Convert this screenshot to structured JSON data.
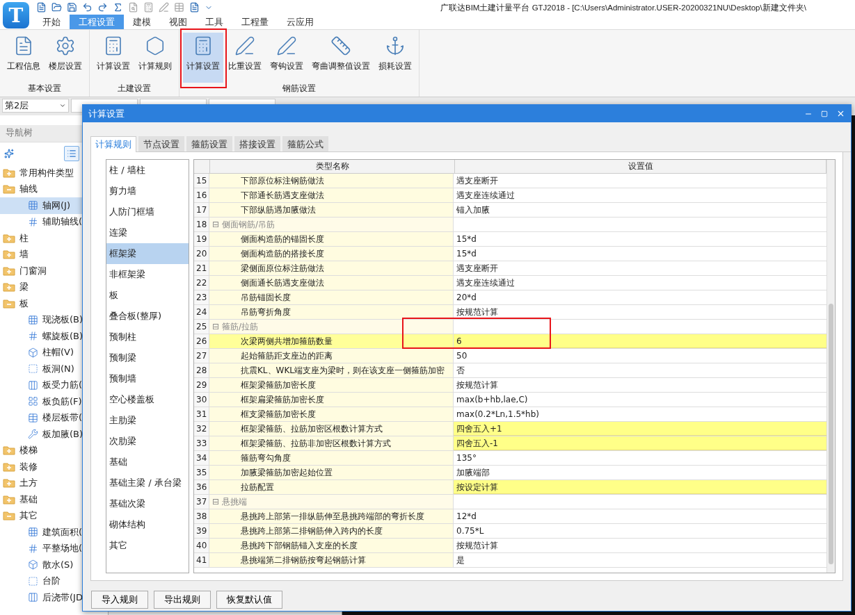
{
  "app": {
    "logo": "T",
    "title": "广联达BIM土建计量平台 GTJ2018 - [C:\\Users\\Administrator.USER-20200321NU\\Desktop\\新建文件夹\\"
  },
  "tabs": [
    {
      "label": "开始",
      "selected": false
    },
    {
      "label": "工程设置",
      "selected": true
    },
    {
      "label": "建模",
      "selected": false
    },
    {
      "label": "视图",
      "selected": false
    },
    {
      "label": "工具",
      "selected": false
    },
    {
      "label": "工程量",
      "selected": false
    },
    {
      "label": "云应用",
      "selected": false
    }
  ],
  "ribbon": [
    {
      "group": "基本设置",
      "buttons": [
        {
          "label": "工程信息",
          "selected": false
        },
        {
          "label": "楼层设置",
          "selected": false
        }
      ]
    },
    {
      "group": "土建设置",
      "buttons": [
        {
          "label": "计算设置",
          "selected": false
        },
        {
          "label": "计算规则",
          "selected": false
        }
      ]
    },
    {
      "group": "钢筋设置",
      "buttons": [
        {
          "label": "计算设置",
          "selected": true
        },
        {
          "label": "比重设置",
          "selected": false
        },
        {
          "label": "弯钩设置",
          "selected": false
        },
        {
          "label": "弯曲调整值设置",
          "selected": false
        },
        {
          "label": "损耗设置",
          "selected": false
        }
      ]
    }
  ],
  "selectors": [
    {
      "value": "第2层"
    }
  ],
  "navigator": {
    "title": "导航树",
    "tree": [
      {
        "label": "常用构件类型",
        "expanded": false
      },
      {
        "label": "轴线",
        "expanded": true,
        "children": [
          {
            "label": "轴网(J)",
            "selected": true
          },
          {
            "label": "辅助轴线(",
            "selected": false
          }
        ]
      },
      {
        "label": "柱",
        "expanded": false
      },
      {
        "label": "墙",
        "expanded": false
      },
      {
        "label": "门窗洞",
        "expanded": false
      },
      {
        "label": "梁",
        "expanded": false
      },
      {
        "label": "板",
        "expanded": true,
        "children": [
          {
            "label": "现浇板(B)",
            "selected": false
          },
          {
            "label": "螺旋板(B)",
            "selected": false
          },
          {
            "label": "柱帽(V)",
            "selected": false
          },
          {
            "label": "板洞(N)",
            "selected": false
          },
          {
            "label": "板受力筋(",
            "selected": false
          },
          {
            "label": "板负筋(F)",
            "selected": false
          },
          {
            "label": "楼层板带(",
            "selected": false
          },
          {
            "label": "板加腋(B)",
            "selected": false
          }
        ]
      },
      {
        "label": "楼梯",
        "expanded": false
      },
      {
        "label": "装修",
        "expanded": false
      },
      {
        "label": "土方",
        "expanded": false
      },
      {
        "label": "基础",
        "expanded": false
      },
      {
        "label": "其它",
        "expanded": true,
        "children": [
          {
            "label": "建筑面积(",
            "selected": false
          },
          {
            "label": "平整场地(",
            "selected": false
          },
          {
            "label": "散水(S)",
            "selected": false
          },
          {
            "label": "台阶",
            "selected": false
          },
          {
            "label": "后浇带(JD",
            "selected": false
          }
        ]
      }
    ]
  },
  "dialog": {
    "title": "计算设置",
    "tabs": [
      {
        "label": "计算规则",
        "selected": true
      },
      {
        "label": "节点设置",
        "selected": false
      },
      {
        "label": "箍筋设置",
        "selected": false
      },
      {
        "label": "搭接设置",
        "selected": false
      },
      {
        "label": "箍筋公式",
        "selected": false
      }
    ],
    "categories": [
      {
        "label": "柱 / 墙柱",
        "selected": false
      },
      {
        "label": "剪力墙",
        "selected": false
      },
      {
        "label": "人防门框墙",
        "selected": false
      },
      {
        "label": "连梁",
        "selected": false
      },
      {
        "label": "框架梁",
        "selected": true
      },
      {
        "label": "非框架梁",
        "selected": false
      },
      {
        "label": "板",
        "selected": false
      },
      {
        "label": "叠合板(整厚)",
        "selected": false
      },
      {
        "label": "预制柱",
        "selected": false
      },
      {
        "label": "预制梁",
        "selected": false
      },
      {
        "label": "预制墙",
        "selected": false
      },
      {
        "label": "空心楼盖板",
        "selected": false
      },
      {
        "label": "主肋梁",
        "selected": false
      },
      {
        "label": "次肋梁",
        "selected": false
      },
      {
        "label": "基础",
        "selected": false
      },
      {
        "label": "基础主梁 / 承台梁",
        "selected": false
      },
      {
        "label": "基础次梁",
        "selected": false
      },
      {
        "label": "砌体结构",
        "selected": false
      },
      {
        "label": "其它",
        "selected": false
      }
    ],
    "columns": [
      "类型名称",
      "设置值"
    ],
    "rows": [
      {
        "num": "15",
        "kind": "item",
        "name": "下部原位标注钢筋做法",
        "value": "遇支座断开",
        "highlighted": false,
        "selected": false
      },
      {
        "num": "16",
        "kind": "item",
        "name": "下部通长筋遇支座做法",
        "value": "遇支座连续通过",
        "highlighted": false,
        "selected": false
      },
      {
        "num": "17",
        "kind": "item",
        "name": "下部纵筋遇加腋做法",
        "value": "锚入加腋",
        "highlighted": false,
        "selected": false
      },
      {
        "num": "18",
        "kind": "group",
        "name": "侧面钢筋/吊筋",
        "toggle": "⊟",
        "selected": false
      },
      {
        "num": "19",
        "kind": "item",
        "name": "侧面构造筋的锚固长度",
        "value": "15*d",
        "highlighted": false,
        "selected": false
      },
      {
        "num": "20",
        "kind": "item",
        "name": "侧面构造筋的搭接长度",
        "value": "15*d",
        "highlighted": false,
        "selected": false
      },
      {
        "num": "21",
        "kind": "item",
        "name": "梁侧面原位标注筋做法",
        "value": "遇支座断开",
        "highlighted": false,
        "selected": false
      },
      {
        "num": "22",
        "kind": "item",
        "name": "侧面通长筋遇支座做法",
        "value": "遇支座连续通过",
        "highlighted": false,
        "selected": false
      },
      {
        "num": "23",
        "kind": "item",
        "name": "吊筋锚固长度",
        "value": "20*d",
        "highlighted": false,
        "selected": false
      },
      {
        "num": "24",
        "kind": "item",
        "name": "吊筋弯折角度",
        "value": "按规范计算",
        "highlighted": false,
        "selected": false
      },
      {
        "num": "25",
        "kind": "group",
        "name": "箍筋/拉筋",
        "toggle": "⊟",
        "selected": false
      },
      {
        "num": "26",
        "kind": "item",
        "name": "次梁两侧共增加箍筋数量",
        "value": "6",
        "highlighted": true,
        "selected": true
      },
      {
        "num": "27",
        "kind": "item",
        "name": "起始箍筋距支座边的距离",
        "value": "50",
        "highlighted": false,
        "selected": false
      },
      {
        "num": "28",
        "kind": "item",
        "name": "抗震KL、WKL端支座为梁时，则在该支座一侧箍筋加密",
        "value": "否",
        "highlighted": false,
        "selected": false
      },
      {
        "num": "29",
        "kind": "item",
        "name": "框架梁箍筋加密长度",
        "value": "按规范计算",
        "highlighted": false,
        "selected": false
      },
      {
        "num": "30",
        "kind": "item",
        "name": "框架扁梁箍筋加密长度",
        "value": "max(b+hb,lae,C)",
        "highlighted": false,
        "selected": false
      },
      {
        "num": "31",
        "kind": "item",
        "name": "框支梁箍筋加密长度",
        "value": "max(0.2*Ln,1.5*hb)",
        "highlighted": false,
        "selected": false
      },
      {
        "num": "32",
        "kind": "item",
        "name": "框架梁箍筋、拉筋加密区根数计算方式",
        "value": "四舍五入+1",
        "highlighted": true,
        "selected": false
      },
      {
        "num": "33",
        "kind": "item",
        "name": "框架梁箍筋、拉筋非加密区根数计算方式",
        "value": "四舍五入-1",
        "highlighted": true,
        "selected": false
      },
      {
        "num": "34",
        "kind": "item",
        "name": "箍筋弯勾角度",
        "value": "135°",
        "highlighted": false,
        "selected": false
      },
      {
        "num": "35",
        "kind": "item",
        "name": "加腋梁箍筋加密起始位置",
        "value": "加腋端部",
        "highlighted": false,
        "selected": false
      },
      {
        "num": "36",
        "kind": "item",
        "name": "拉筋配置",
        "value": "按设定计算",
        "highlighted": true,
        "selected": false
      },
      {
        "num": "37",
        "kind": "group",
        "name": "悬挑端",
        "toggle": "⊟",
        "selected": false
      },
      {
        "num": "38",
        "kind": "item",
        "name": "悬挑跨上部第一排纵筋伸至悬挑跨端部的弯折长度",
        "value": "12*d",
        "highlighted": false,
        "selected": false
      },
      {
        "num": "39",
        "kind": "item",
        "name": "悬挑跨上部第二排钢筋伸入跨内的长度",
        "value": "0.75*L",
        "highlighted": false,
        "selected": false
      },
      {
        "num": "40",
        "kind": "item",
        "name": "悬挑跨下部钢筋锚入支座的长度",
        "value": "按规范计算",
        "highlighted": false,
        "selected": false
      },
      {
        "num": "41",
        "kind": "item",
        "name": "悬挑端第二排钢筋按弯起钢筋计算",
        "value": "是",
        "highlighted": false,
        "selected": false
      }
    ],
    "buttons": [
      "导入规则",
      "导出规则",
      "恢复默认值"
    ]
  }
}
